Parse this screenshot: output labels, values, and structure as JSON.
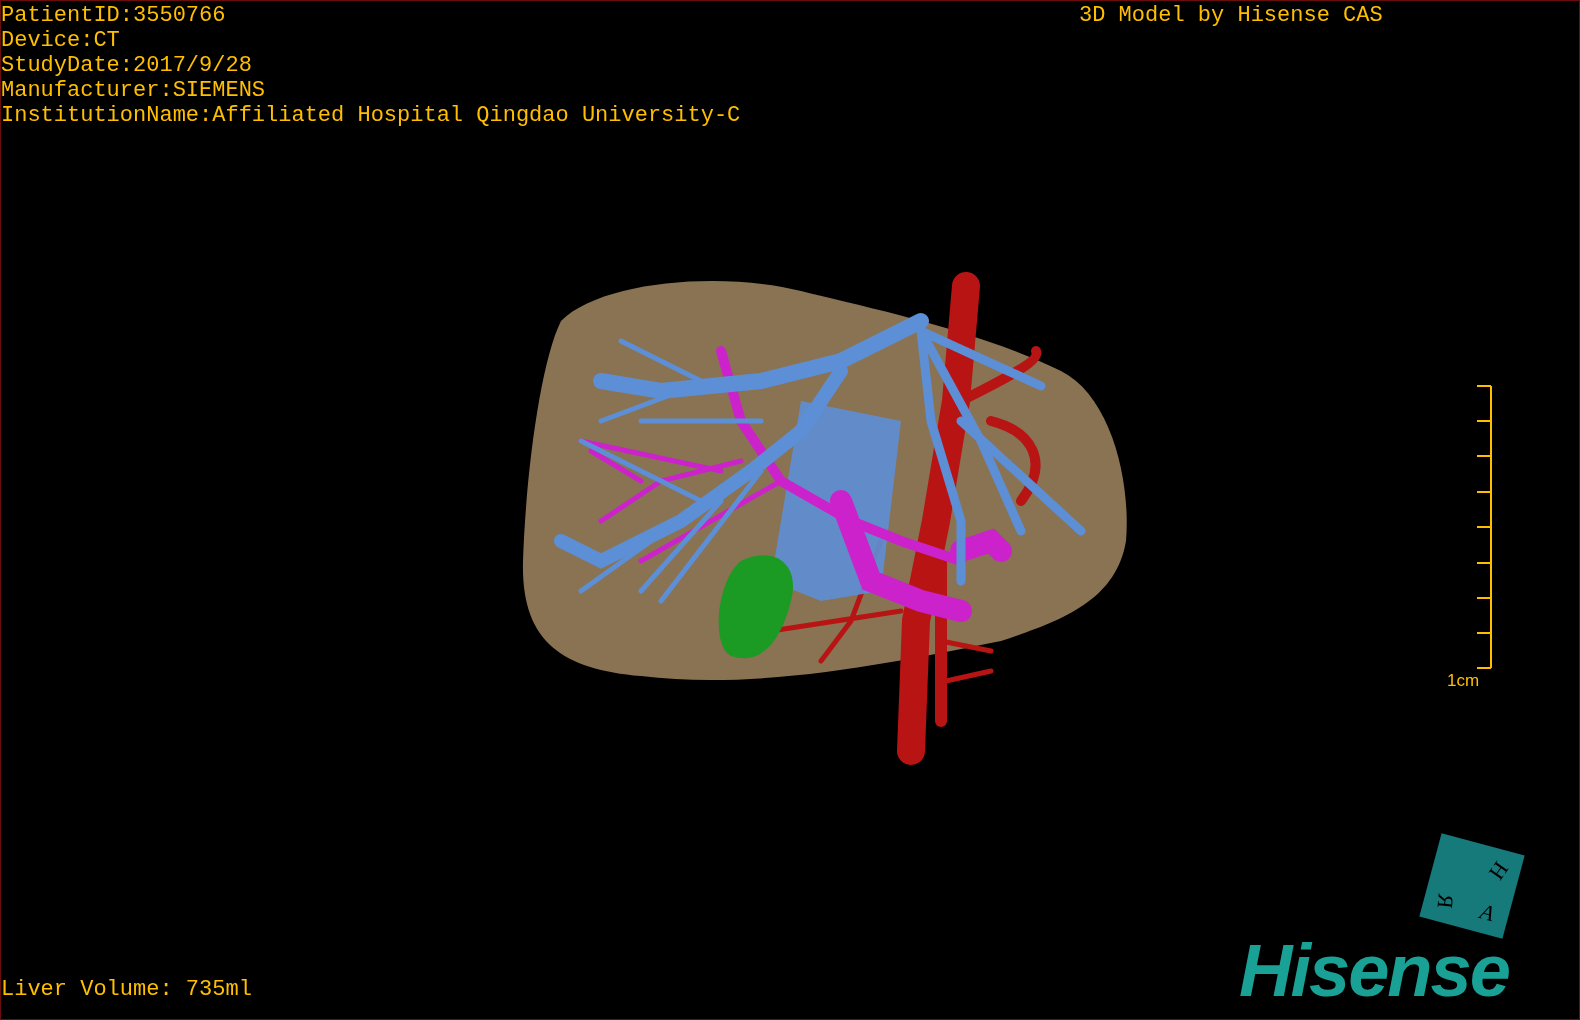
{
  "study_info": [
    "PatientID:3550766",
    "Device:CT",
    "StudyDate:2017/9/28",
    "Manufacturer:SIEMENS",
    "InstitutionName:Affiliated Hospital Qingdao University-C"
  ],
  "header_right": "3D Model by Hisense CAS",
  "scale_bar": {
    "label": "1cm"
  },
  "orientation_cube": {
    "top": "H",
    "left": "R",
    "right": "A"
  },
  "logo": "Hisense",
  "liver_volume": "Liver Volume: 735ml"
}
